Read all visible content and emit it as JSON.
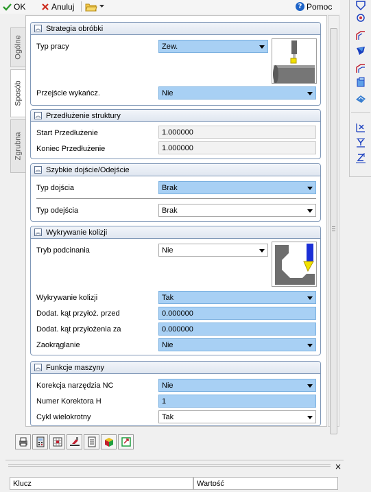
{
  "toolbar": {
    "ok_label": "OK",
    "cancel_label": "Anuluj",
    "help_label": "Pomoc",
    "help_glyph": "?"
  },
  "tabs": [
    {
      "label": "Ogólne",
      "active": false
    },
    {
      "label": "Sposób",
      "active": true
    },
    {
      "label": "Zgrubna",
      "active": false
    }
  ],
  "sections": {
    "strategia": {
      "title": "Strategia obróbki",
      "typ_pracy": {
        "label": "Typ pracy",
        "value": "Zew."
      },
      "przejscie": {
        "label": "Przejście wykańcz.",
        "value": "Nie"
      }
    },
    "przedluzenie": {
      "title": "Przedłużenie struktury",
      "start": {
        "label": "Start Przedłużenie",
        "value": "1.000000"
      },
      "koniec": {
        "label": "Koniec Przedłużenie",
        "value": "1.000000"
      }
    },
    "szybkie": {
      "title": "Szybkie dojście/Odejście",
      "typ_dojscia": {
        "label": "Typ dojścia",
        "value": "Brak"
      },
      "typ_odejscia": {
        "label": "Typ odejścia",
        "value": "Brak"
      }
    },
    "kolizje": {
      "title": "Wykrywanie kolizji",
      "tryb": {
        "label": "Tryb podcinania",
        "value": "Nie"
      },
      "wykrywanie": {
        "label": "Wykrywanie kolizji",
        "value": "Tak"
      },
      "kat_przed": {
        "label": "Dodat. kąt przyłoż. przed",
        "value": "0.000000"
      },
      "kat_za": {
        "label": "Dodat. kąt przyłożenia za",
        "value": "0.000000"
      },
      "zaokraglanie": {
        "label": "Zaokrąglanie",
        "value": "Nie"
      }
    },
    "funkcje": {
      "title": "Funkcje maszyny",
      "korekcja": {
        "label": "Korekcja narzędzia NC",
        "value": "Nie"
      },
      "numer": {
        "label": "Numer Korektora H",
        "value": "1"
      },
      "cykl": {
        "label": "Cykl wielokrotny",
        "value": "Tak"
      }
    }
  },
  "bottom_table": {
    "col_key": "Klucz",
    "col_value": "Wartość",
    "close_glyph": "×"
  },
  "colors": {
    "highlight": "#a8d0f4",
    "section_border": "#7f97b7",
    "accent_blue": "#1e64c8"
  }
}
